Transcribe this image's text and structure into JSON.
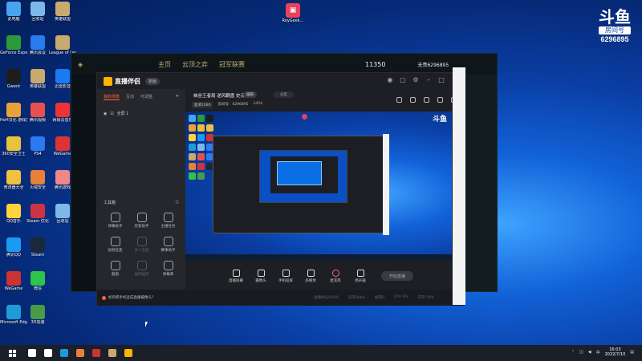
{
  "desktop": {
    "icons_col1": [
      {
        "label": "此电脑",
        "color": "#4aa3f0"
      },
      {
        "label": "GeForce Experience",
        "color": "#2a9a3a"
      },
      {
        "label": "Gwent",
        "color": "#1d1d1d"
      },
      {
        "label": "HoH汉化 游戏加速器",
        "color": "#e9a13a"
      },
      {
        "label": "360安全卫士",
        "color": "#e8c23a"
      },
      {
        "label": "修改器大全",
        "color": "#f0c040"
      },
      {
        "label": "QQ音乐",
        "color": "#ffd43a"
      },
      {
        "label": "腾讯QQ",
        "color": "#1a9af0"
      },
      {
        "label": "WeGame",
        "color": "#c33"
      },
      {
        "label": "Microsoft Edge",
        "color": "#1e9bd7"
      }
    ],
    "icons_col2": [
      {
        "label": "回收站",
        "color": "#7cb9e8"
      },
      {
        "label": "腾讯会议",
        "color": "#2a7af0"
      },
      {
        "label": "英雄联盟",
        "color": "#c8aa6e"
      },
      {
        "label": "腾讯视频",
        "color": "#e85050"
      },
      {
        "label": "PS4",
        "color": "#2a7af0"
      },
      {
        "label": "火绒安全",
        "color": "#e8803a"
      },
      {
        "label": "Steam 优化",
        "color": "#cc3344"
      },
      {
        "label": "Steam",
        "color": "#1b2838"
      },
      {
        "label": "微信",
        "color": "#2ec44a"
      },
      {
        "label": "3D加速",
        "color": "#4a9a4a"
      }
    ],
    "icons_col3": [
      {
        "label": "英雄联盟",
        "color": "#c8aa6e"
      },
      {
        "label": "League of Legends",
        "color": "#c8aa6e"
      },
      {
        "label": "迅雷影音",
        "color": "#1a7af0"
      },
      {
        "label": "网易云音乐",
        "color": "#e33"
      },
      {
        "label": "WeGame",
        "color": "#d33"
      },
      {
        "label": "腾讯游戏",
        "color": "#e88"
      },
      {
        "label": "回收站",
        "color": "#7cb9e8"
      }
    ],
    "center_icon_label": "RoyGeek..."
  },
  "watermark": {
    "logo": "斗鱼",
    "room_label": "房间号",
    "room_number": "6296895"
  },
  "lol_client": {
    "title": "英雄联盟",
    "tabs": [
      "主页",
      "云顶之弈",
      "冠军联赛"
    ],
    "currency": "11350",
    "summoner": "无畏6296895"
  },
  "streaming_app": {
    "title": "直播伴侣",
    "version_pill": "新版",
    "tabs": [
      "我的场景",
      "互动",
      "可调整"
    ],
    "scene": "全屏 1",
    "room_title": "峡谷王者局 逆风翻盘 史诗巨龙",
    "edit_label": "编辑",
    "category_label": "分区",
    "meta": {
      "quality": "超清1080",
      "room": "房间号：6296895",
      "fans": "1454"
    },
    "tools_title": "工具箱",
    "tools": [
      {
        "label": "弹幕助手",
        "dim": false
      },
      {
        "label": "房管助手",
        "dim": false
      },
      {
        "label": "主播任务",
        "dim": false
      },
      {
        "label": "视频连麦",
        "dim": false
      },
      {
        "label": "多人连麦",
        "dim": true
      },
      {
        "label": "赛事助手",
        "dim": false
      },
      {
        "label": "截图",
        "dim": false
      },
      {
        "label": "福利抽奖",
        "dim": true
      },
      {
        "label": "弹幕库",
        "dim": false
      }
    ],
    "controls": [
      "直播屏幕",
      "摄像头",
      "手机投屏",
      "多媒体",
      "麦克风",
      "扬声器"
    ],
    "start_button": "开始直播",
    "status_tip": "如何把手机变成直播摄像头？",
    "stats": [
      "直播时长00:00",
      "码率0kb/s",
      "帧率0",
      "CPU 8%",
      "内存 54%"
    ],
    "preview_badge": "斗鱼"
  },
  "taskbar": {
    "time": "16:03",
    "date": "2022/7/10",
    "apps": [
      {
        "name": "search",
        "color": "#ffffff"
      },
      {
        "name": "task-view",
        "color": "#ffffff"
      },
      {
        "name": "edge",
        "color": "#1e9bd7"
      },
      {
        "name": "stream-tool",
        "color": "#e8803a"
      },
      {
        "name": "wegame",
        "color": "#c33"
      },
      {
        "name": "league",
        "color": "#c8aa6e"
      },
      {
        "name": "douyu",
        "color": "#ffb400"
      }
    ]
  }
}
